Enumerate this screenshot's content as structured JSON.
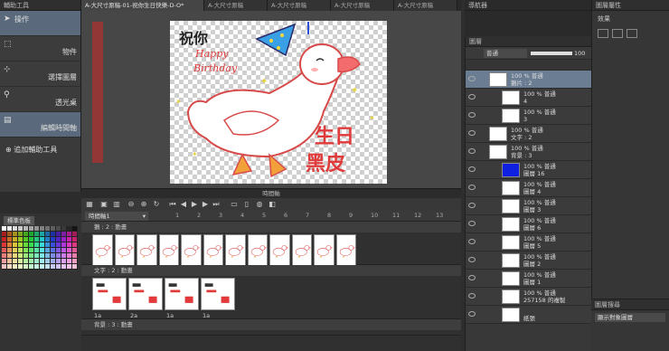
{
  "left_panel": {
    "title": "輔助工具",
    "tools": [
      {
        "label": "操作",
        "icon": "arrow-cursor-icon"
      },
      {
        "label": "物件",
        "icon": "object-select-icon"
      },
      {
        "label": "選擇圖層",
        "icon": "layer-select-icon"
      },
      {
        "label": "透光桌",
        "icon": "lightbox-icon"
      },
      {
        "label": "編輯時間軸",
        "icon": "timeline-edit-icon"
      }
    ],
    "add_tool_label": "追加輔助工具",
    "color_title": "標準色板"
  },
  "tabs": [
    {
      "label": "A-大尺寸原稿-01-祝你生日快樂-D-O*",
      "active": true
    },
    {
      "label": "A-大尺寸原稿",
      "active": false
    },
    {
      "label": "A-大尺寸原稿",
      "active": false
    },
    {
      "label": "A-大尺寸原稿",
      "active": false
    },
    {
      "label": "A-大尺寸原稿",
      "active": false
    }
  ],
  "canvas": {
    "text_top": "祝你",
    "text_happy": "Happy",
    "text_birthday": "Birthday",
    "text_big": "生日",
    "text_name": "黑皮"
  },
  "timeline": {
    "title": "時間軸",
    "track_selector": "時間軸1",
    "frame_numbers": [
      "1",
      "2",
      "3",
      "4",
      "5",
      "6",
      "7",
      "8",
      "9",
      "10",
      "11",
      "12",
      "13"
    ],
    "tracks": [
      {
        "name": "鵝 : 2 : 動畫",
        "cell_labels": [
          "3",
          "4",
          "3",
          "4",
          "3",
          "4",
          "3",
          "4",
          "3",
          "4",
          "3",
          "4"
        ]
      },
      {
        "name": "文字 : 2 : 動畫",
        "cell_labels": [
          "1a",
          "2a",
          "1a",
          "1a"
        ]
      },
      {
        "name": "背景 : 3 : 動畫",
        "cell_labels": []
      }
    ]
  },
  "layer_panel": {
    "title": "圖層",
    "blend_mode": "普通",
    "opacity": "100",
    "layers": [
      {
        "line1": "100 % 普通",
        "line2": "鵝片 : 2",
        "selected": true
      },
      {
        "line1": "100 % 普通",
        "line2": "4",
        "selected": false
      },
      {
        "line1": "100 % 普通",
        "line2": "3",
        "selected": false
      },
      {
        "line1": "100 % 普通",
        "line2": "文字 : 2",
        "selected": false
      },
      {
        "line1": "100 % 普通",
        "line2": "背景 : 3",
        "selected": false
      },
      {
        "line1": "100 % 普通",
        "line2": "圖層 16",
        "selected": false
      },
      {
        "line1": "100 % 普通",
        "line2": "圖層 4",
        "selected": false
      },
      {
        "line1": "100 % 普通",
        "line2": "圖層 3",
        "selected": false
      },
      {
        "line1": "100 % 普通",
        "line2": "圖層 6",
        "selected": false
      },
      {
        "line1": "100 % 普通",
        "line2": "圖層 5",
        "selected": false
      },
      {
        "line1": "100 % 普通",
        "line2": "圖層 2",
        "selected": false
      },
      {
        "line1": "100 % 普通",
        "line2": "圖層 1",
        "selected": false
      },
      {
        "line1": "100 % 普通",
        "line2": "257158 的複製",
        "selected": false
      },
      {
        "line1": "",
        "line2": "紙張",
        "selected": false
      }
    ]
  },
  "property_panel": {
    "title": "圖層屬性",
    "effect_label": "效果"
  },
  "search_panel": {
    "title": "圖層搜尋",
    "filter_label": "顯示對象圖層"
  },
  "navigator_tab": "導航器"
}
